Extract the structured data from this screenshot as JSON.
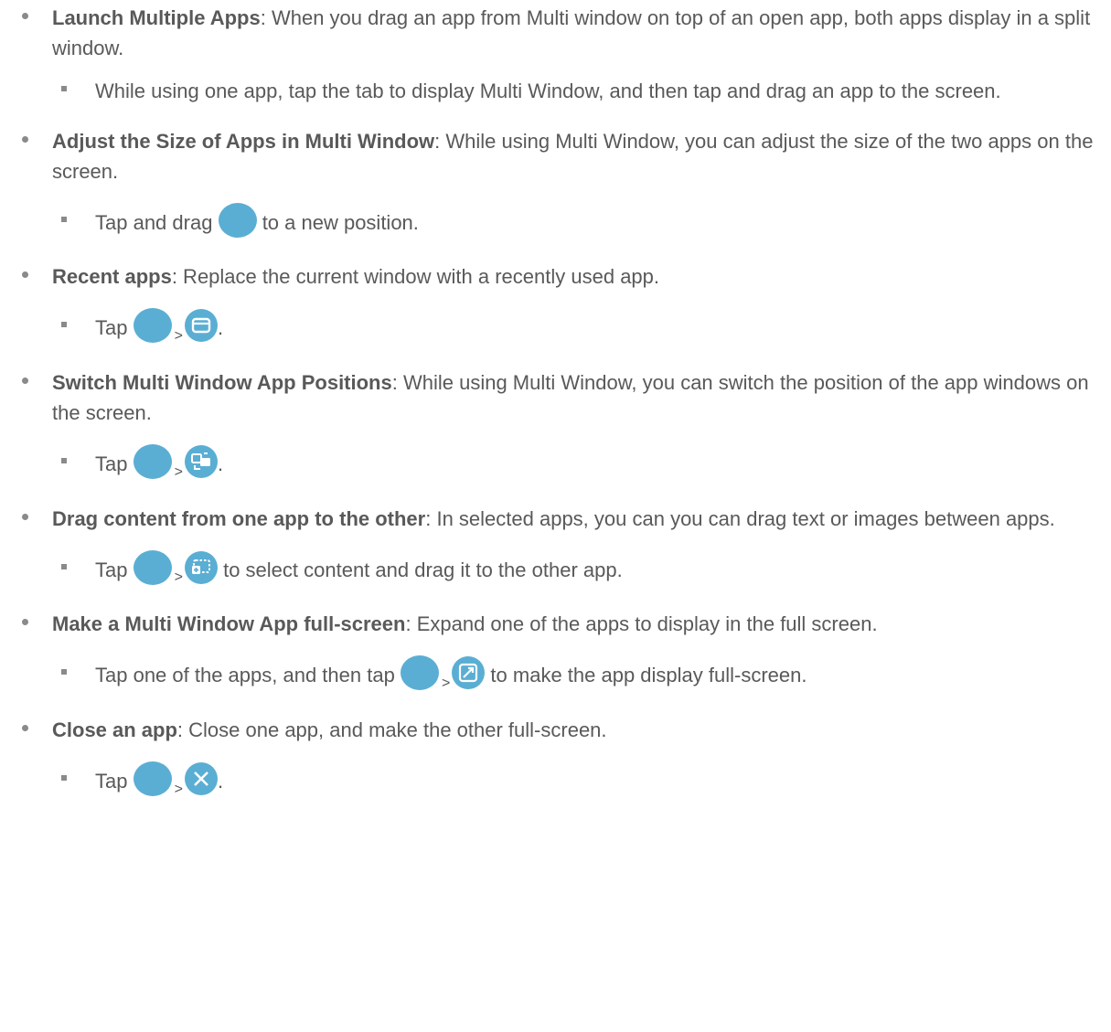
{
  "items": [
    {
      "title": "Launch Multiple Apps",
      "desc": ": When you drag an app from Multi window on top of an open app, both apps display in a split window.",
      "sub": "While using one app, tap the tab to display Multi Window, and then tap and drag an app to the screen."
    },
    {
      "title": "Adjust the Size of Apps in Multi Window",
      "desc": ": While using Multi Window, you can adjust the size of the two apps on the screen.",
      "sub_pre": "Tap and drag",
      "sub_post": "to a new position."
    },
    {
      "title": "Recent apps",
      "desc": ": Replace the current window with a recently used app.",
      "sub_pre": "Tap",
      "sep": ">",
      "end": "."
    },
    {
      "title": "Switch Multi Window App Positions",
      "desc": ": While using Multi Window, you can switch the position of the app windows on the screen.",
      "sub_pre": "Tap",
      "sep": ">",
      "end": "."
    },
    {
      "title": "Drag content from one app to the other",
      "desc": ": In selected apps, you can you can drag text or images between apps.",
      "sub_pre": "Tap",
      "sep": ">",
      "sub_post": "to select content and drag it to the other app."
    },
    {
      "title": "Make a Multi Window App full-screen",
      "desc": ": Expand one of the apps to display in the full screen.",
      "sub_pre": "Tap one of the apps, and then tap",
      "sep": ">",
      "sub_post": "to make the app display full-screen."
    },
    {
      "title": "Close an app",
      "desc": ": Close one app, and make the other full-screen.",
      "sub_pre": "Tap",
      "sep": ">",
      "end": "."
    }
  ],
  "icons": {
    "handle": "window-handle-icon",
    "recent": "recent-apps-icon",
    "switch": "switch-windows-icon",
    "drag": "drag-content-icon",
    "expand": "expand-fullscreen-icon",
    "close": "close-app-icon",
    "accent": "#5aaed3"
  }
}
